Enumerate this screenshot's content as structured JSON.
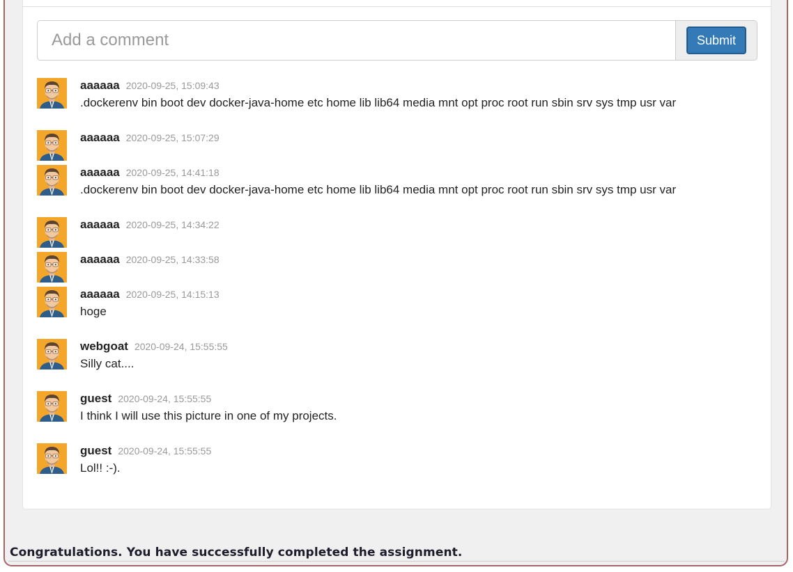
{
  "comment_form": {
    "placeholder": "Add a comment",
    "submit_label": "Submit"
  },
  "comments": [
    {
      "user": "aaaaaa",
      "timestamp": "2020-09-25, 15:09:43",
      "text": ".dockerenv bin boot dev docker-java-home etc home lib lib64 media mnt opt proc root run sbin srv sys tmp usr var"
    },
    {
      "user": "aaaaaa",
      "timestamp": "2020-09-25, 15:07:29",
      "text": ""
    },
    {
      "user": "aaaaaa",
      "timestamp": "2020-09-25, 14:41:18",
      "text": ".dockerenv bin boot dev docker-java-home etc home lib lib64 media mnt opt proc root run sbin srv sys tmp usr var"
    },
    {
      "user": "aaaaaa",
      "timestamp": "2020-09-25, 14:34:22",
      "text": ""
    },
    {
      "user": "aaaaaa",
      "timestamp": "2020-09-25, 14:33:58",
      "text": ""
    },
    {
      "user": "aaaaaa",
      "timestamp": "2020-09-25, 14:15:13",
      "text": "hoge"
    },
    {
      "user": "webgoat",
      "timestamp": "2020-09-24, 15:55:55",
      "text": "Silly cat...."
    },
    {
      "user": "guest",
      "timestamp": "2020-09-24, 15:55:55",
      "text": "I think I will use this picture in one of my projects."
    },
    {
      "user": "guest",
      "timestamp": "2020-09-24, 15:55:55",
      "text": "Lol!! :-)."
    }
  ],
  "feedback": {
    "message": "Congratulations. You have successfully completed the assignment."
  },
  "colors": {
    "accent": "#337ab7",
    "frame_border": "#a66464",
    "avatar_background": "#f4a62a"
  },
  "icons": {
    "avatar": "user-avatar-icon"
  }
}
